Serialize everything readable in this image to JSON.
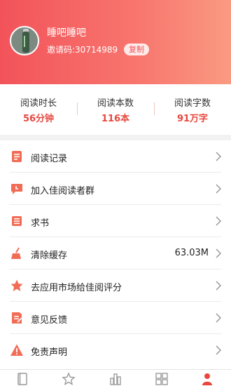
{
  "profile": {
    "username": "睡吧睡吧",
    "invite_code": "邀请码:30714989",
    "copy_label": "复制"
  },
  "stats": [
    {
      "label": "阅读时长",
      "value": "56分钟"
    },
    {
      "label": "阅读本数",
      "value": "116本"
    },
    {
      "label": "阅读字数",
      "value": "91万字"
    }
  ],
  "menu": [
    {
      "label": "阅读记录",
      "icon": "reading-record-icon",
      "value": ""
    },
    {
      "label": "加入佳阅读者群",
      "icon": "chat-group-icon",
      "value": ""
    },
    {
      "label": "求书",
      "icon": "request-book-icon",
      "value": ""
    },
    {
      "label": "清除缓存",
      "icon": "broom-icon",
      "value": "63.03M"
    },
    {
      "label": "去应用市场给佳阅评分",
      "icon": "star-icon",
      "value": ""
    },
    {
      "label": "意见反馈",
      "icon": "feedback-icon",
      "value": ""
    },
    {
      "label": "免责声明",
      "icon": "warning-icon",
      "value": ""
    }
  ],
  "tabbar": [
    {
      "icon": "bookshelf-icon",
      "active": false
    },
    {
      "icon": "star-icon",
      "active": false
    },
    {
      "icon": "ranking-icon",
      "active": false
    },
    {
      "icon": "category-grid-icon",
      "active": false
    },
    {
      "icon": "profile-icon",
      "active": true
    }
  ],
  "colors": {
    "accent": "#e8473e",
    "header_start": "#f2535a",
    "header_end": "#fa9a82",
    "icon_accent": "#f26c55",
    "tab_inactive": "#9a9a9a"
  }
}
